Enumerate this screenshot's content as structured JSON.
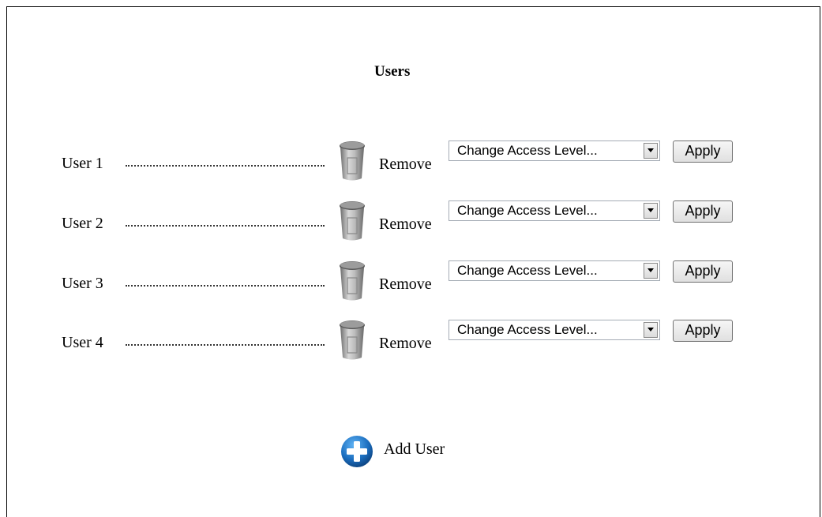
{
  "page": {
    "title": "Users"
  },
  "users": [
    {
      "name": "User 1",
      "remove_label": "Remove",
      "access_select": "Change Access Level...",
      "apply_label": "Apply"
    },
    {
      "name": "User 2",
      "remove_label": "Remove",
      "access_select": "Change Access Level...",
      "apply_label": "Apply"
    },
    {
      "name": "User 3",
      "remove_label": "Remove",
      "access_select": "Change Access Level...",
      "apply_label": "Apply"
    },
    {
      "name": "User 4",
      "remove_label": "Remove",
      "access_select": "Change Access Level...",
      "apply_label": "Apply"
    }
  ],
  "add_user": {
    "label": "Add User"
  },
  "icons": {
    "remove": "trash-can-icon",
    "add": "plus-circle-icon"
  },
  "colors": {
    "add_icon_blue": "#1c6fc0",
    "trash_gray": "#9a9a9a"
  }
}
